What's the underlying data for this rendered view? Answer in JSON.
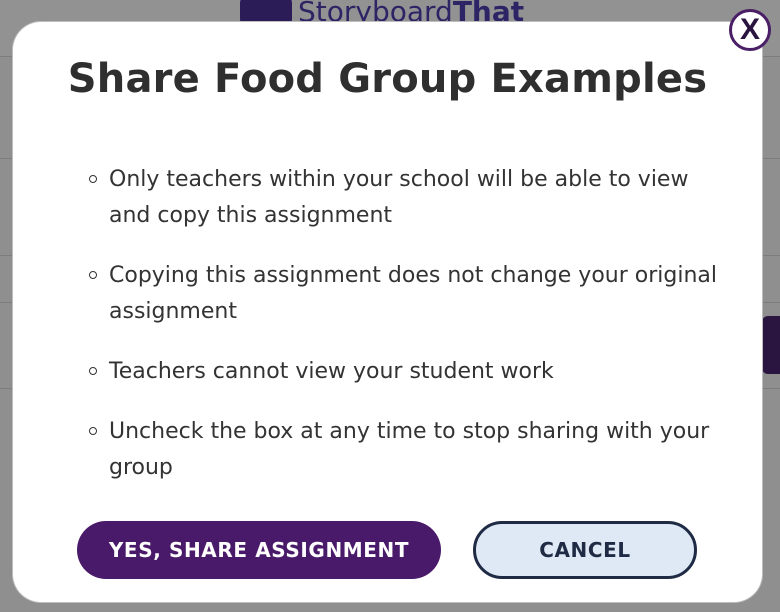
{
  "background": {
    "logo_text_a": "Storyboard",
    "logo_text_b": "That"
  },
  "modal": {
    "title": "Share Food Group Examples",
    "close_label": "X",
    "bullets": [
      "Only teachers within your school will be able to view and copy this assignment",
      "Copying this assignment does not change your original assignment",
      "Teachers cannot view your student work",
      "Uncheck the box at any time to stop sharing with your group"
    ],
    "confirm_label": "YES, SHARE ASSIGNMENT",
    "cancel_label": "CANCEL"
  },
  "colors": {
    "primary": "#4a1a6a",
    "secondary_bg": "#dfe9f5",
    "secondary_border": "#1f2b44",
    "overlay": "#8f8f8f"
  }
}
